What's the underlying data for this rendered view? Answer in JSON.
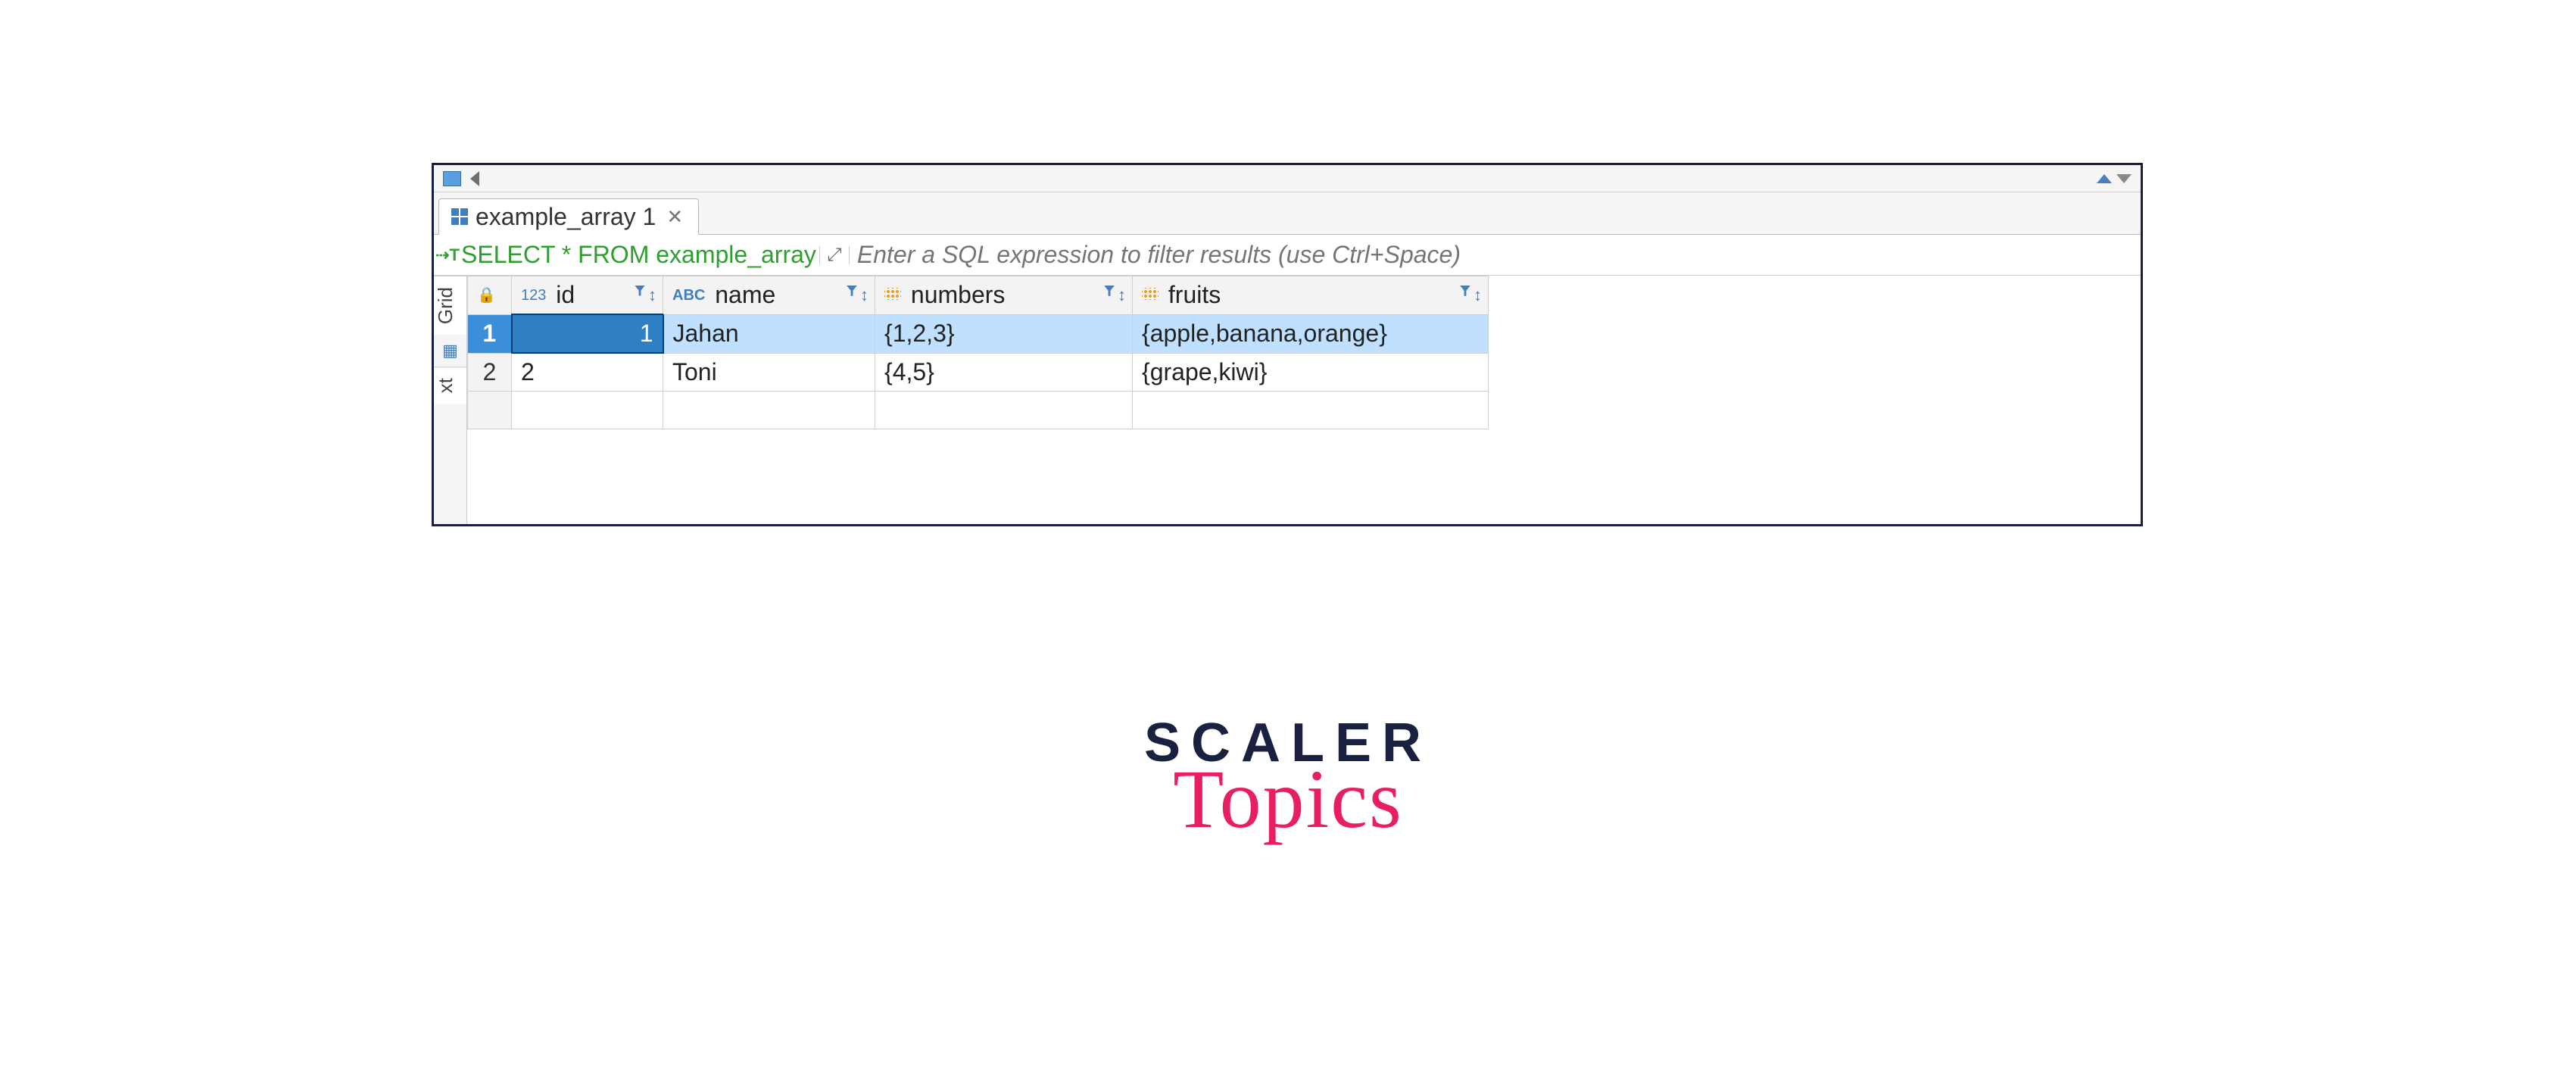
{
  "tab": {
    "title": "example_array 1"
  },
  "sql": {
    "query": "SELECT * FROM example_array",
    "placeholder": "Enter a SQL expression to filter results (use Ctrl+Space)"
  },
  "sideTabs": {
    "grid": "Grid",
    "text": "xt"
  },
  "columns": {
    "id": {
      "label": "id",
      "typeTag": "123"
    },
    "name": {
      "label": "name",
      "typeTag": "ABC"
    },
    "numbers": {
      "label": "numbers"
    },
    "fruits": {
      "label": "fruits"
    }
  },
  "rows": [
    {
      "n": "1",
      "id": "1",
      "name": "Jahan",
      "numbers": "{1,2,3}",
      "fruits": "{apple,banana,orange}"
    },
    {
      "n": "2",
      "id": "2",
      "name": "Toni",
      "numbers": "{4,5}",
      "fruits": "{grape,kiwi}"
    }
  ],
  "logo": {
    "line1": "SCALER",
    "line2": "Topics"
  }
}
